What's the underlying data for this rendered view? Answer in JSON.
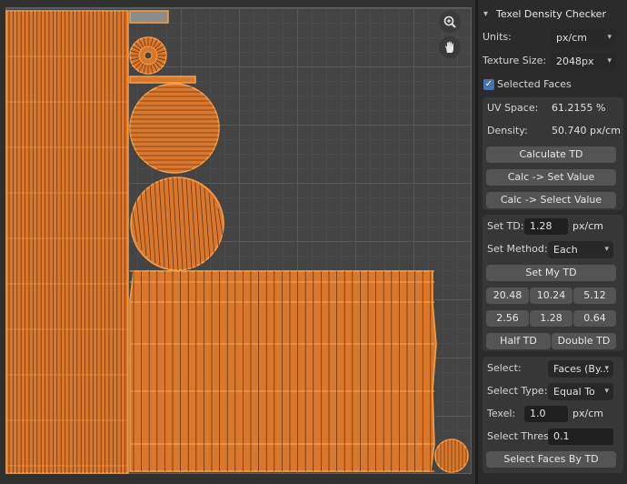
{
  "panel": {
    "title": "Texel Density Checker",
    "units_label": "Units:",
    "units_value": "px/cm",
    "texture_size_label": "Texture Size:",
    "texture_size_value": "2048px",
    "selected_faces_label": "Selected Faces",
    "selected_faces_checked": true,
    "uv_space_label": "UV Space:",
    "uv_space_value": "61.2155 %",
    "density_label": "Density:",
    "density_value": "50.740 px/cm",
    "calculate_td": "Calculate TD",
    "calc_set_value": "Calc -> Set Value",
    "calc_select_value": "Calc -> Select Value",
    "set_td_label": "Set TD:",
    "set_td_value": "1.28",
    "set_td_unit": "px/cm",
    "set_method_label": "Set Method:",
    "set_method_value": "Each",
    "set_my_td": "Set My TD",
    "presets_row1": [
      "20.48",
      "10.24",
      "5.12"
    ],
    "presets_row2": [
      "2.56",
      "1.28",
      "0.64"
    ],
    "half_td": "Half TD",
    "double_td": "Double TD",
    "select_label": "Select:",
    "select_value": "Faces (By...",
    "select_type_label": "Select Type:",
    "select_type_value": "Equal To",
    "texel_label": "Texel:",
    "texel_value": "1.0",
    "texel_unit": "px/cm",
    "select_threshold_label": "Select Thres...",
    "select_threshold_value": "0.1",
    "select_faces_by_td": "Select Faces By TD"
  },
  "viewport": {
    "zoom_icon": "zoom-icon",
    "pan_icon": "hand-icon",
    "uv_color": "#d9782d",
    "uv_edge_color": "#f7a04a",
    "uv_dark_edge": "#6a3410"
  }
}
